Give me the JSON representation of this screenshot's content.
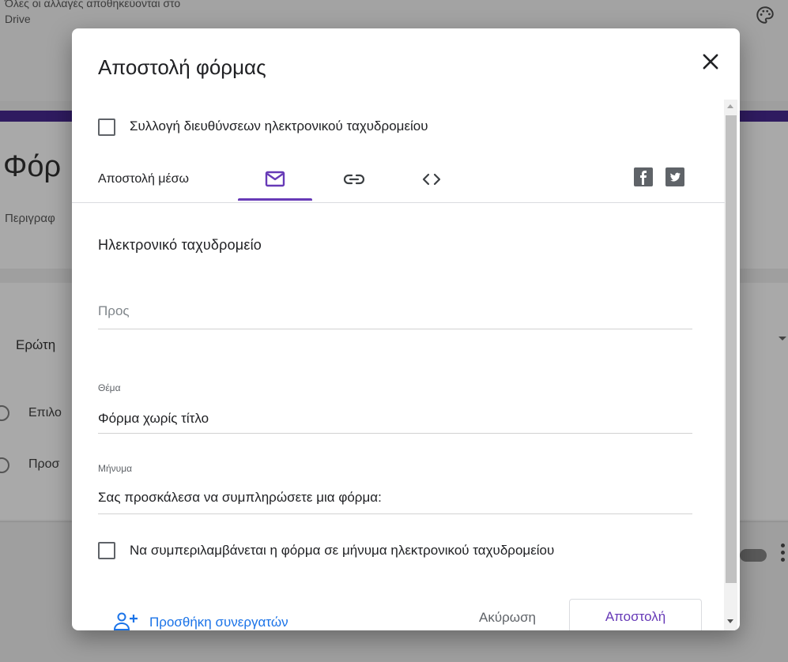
{
  "background": {
    "saved_status": "Όλες οι αλλαγές αποθηκεύονται στο Drive",
    "form_title_partial": "Φόρ",
    "form_description_partial": "Περιγραφ",
    "question_partial": "Ερώτη",
    "option1_partial": "Επιλο",
    "option2_partial": "Προσ"
  },
  "dialog": {
    "title": "Αποστολή φόρμας",
    "collect_emails_label": "Συλλογή διευθύνσεων ηλεκτρονικού ταχυδρομείου",
    "send_via_label": "Αποστολή μέσω",
    "tabs": [
      {
        "name": "email",
        "icon": "mail-icon",
        "selected": true
      },
      {
        "name": "link",
        "icon": "link-icon",
        "selected": false
      },
      {
        "name": "embed",
        "icon": "code-icon",
        "selected": false
      }
    ],
    "section_title": "Ηλεκτρονικό ταχυδρομείο",
    "to_placeholder": "Προς",
    "subject_label": "Θέμα",
    "subject_value": "Φόρμα χωρίς τίτλο",
    "message_label": "Μήνυμα",
    "message_value": "Σας προσκάλεσα να συμπληρώσετε μια φόρμα:",
    "include_form_label": "Να συμπεριλαμβάνεται η φόρμα σε μήνυμα ηλεκτρονικού ταχυδρομείου",
    "add_collaborators_label": "Προσθήκη συνεργατών",
    "cancel_label": "Ακύρωση",
    "send_label": "Αποστολή"
  },
  "colors": {
    "accent": "#673ab7",
    "link": "#1a73e8",
    "text": "#202124",
    "secondary_text": "#5f6368"
  }
}
